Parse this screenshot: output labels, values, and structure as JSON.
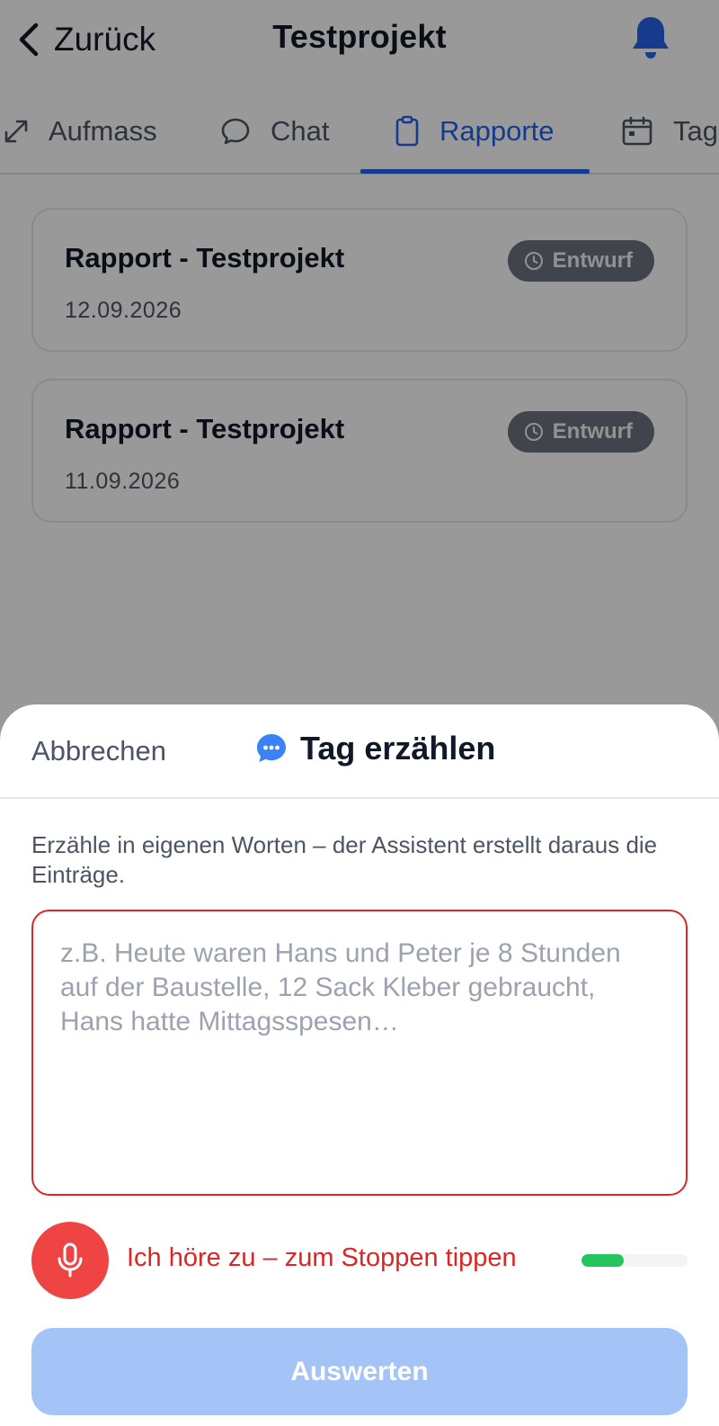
{
  "header": {
    "back_label": "Zurück",
    "title": "Testprojekt"
  },
  "tabs": [
    {
      "label": "Aufmass",
      "icon": "resize-icon",
      "active": false
    },
    {
      "label": "Chat",
      "icon": "chat-bubble-icon",
      "active": false
    },
    {
      "label": "Rapporte",
      "icon": "clipboard-icon",
      "active": true
    },
    {
      "label": "Tage",
      "icon": "calendar-icon",
      "active": false
    }
  ],
  "rapports": [
    {
      "title": "Rapport - Testprojekt",
      "date": "12.09.2026",
      "status": "Entwurf"
    },
    {
      "title": "Rapport - Testprojekt",
      "date": "11.09.2026",
      "status": "Entwurf"
    }
  ],
  "sheet": {
    "cancel_label": "Abbrechen",
    "title": "Tag erzählen",
    "hint": "Erzähle in eigenen Worten – der Assistent erstellt daraus die Einträge.",
    "textarea": {
      "value": "",
      "placeholder": "z.B. Heute waren Hans und Peter je 8 Stunden auf der Baustelle, 12 Sack Kleber gebraucht, Hans hatte Mittagsspesen…"
    },
    "recording": {
      "label": "Ich höre zu – zum Stoppen tippen",
      "level_percent": 40
    },
    "submit_label": "Auswerten"
  },
  "colors": {
    "accent": "#2563eb",
    "recording_red": "#ef4444",
    "level_green": "#22c55e",
    "submit_disabled": "#a4c4f8",
    "badge_gray": "#6b7280"
  }
}
